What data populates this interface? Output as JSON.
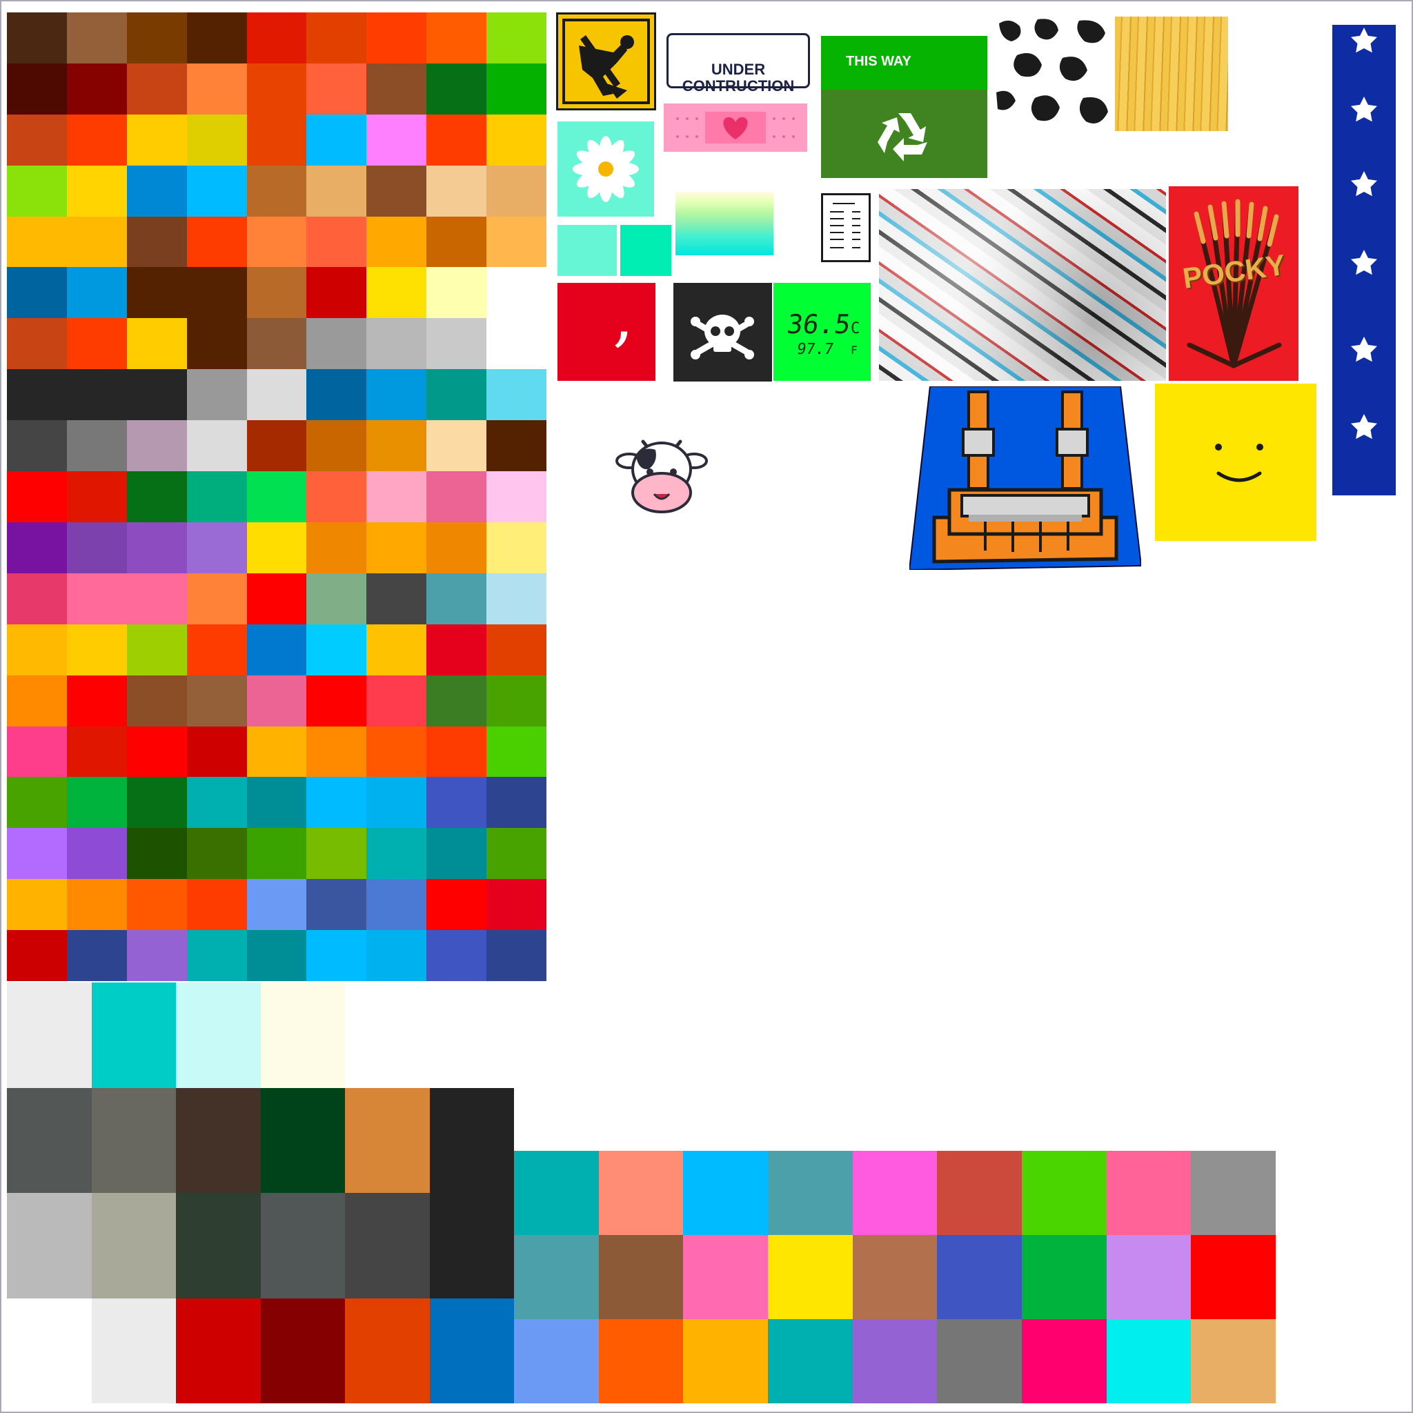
{
  "colors": {
    "background": "#ffffff",
    "frame": "#a9a9b6",
    "sign_yellow": "#f6c500",
    "mint": "#66f5d5",
    "arrow_green": "#05b300",
    "recycle_green": "#3f8421",
    "flag_blue": "#0e2ca3",
    "smiley_yellow": "#ffe600",
    "pocky_red": "#ed1c24",
    "temp_green": "#00ff33",
    "overalls_blue": "#0057e0",
    "overalls_orange": "#f5871f"
  },
  "stickers": {
    "worker_sign_icon": "digging-worker-icon",
    "under_construction_text": "UNDER\nCONTRUCTION",
    "this_way_text": "THIS WAY",
    "recycle_icon": "recycle-icon",
    "bandage_icon": "heart-bandage-icon",
    "daisy_icon": "daisy-icon",
    "receipt_icon": "receipt-icon",
    "comma_glyph": ",",
    "skull_icon": "skull-crossbones-icon",
    "temp_c": "36.5",
    "temp_c_unit": "C",
    "temp_f": "97.7",
    "temp_f_unit": "F",
    "pocky_text": "POCKY",
    "cow_icon": "cow-face-icon",
    "smiley_icon": "smiley-face-icon",
    "star_icon": "star-icon",
    "overalls_icon": "overalls-icon"
  },
  "swatches": {
    "main": [
      "#4a2812",
      "#93603a",
      "#7a3b00",
      "#552200",
      "#e11900",
      "#e24000",
      "#ff3d00",
      "#ff5c00",
      "#8ae20a",
      "#4e0a00",
      "#850200",
      "#c94414",
      "#ff8238",
      "#e84400",
      "#ff623a",
      "#8c4e27",
      "#067016",
      "#04b000",
      "#c94414",
      "#ff3c00",
      "#ffcc00",
      "#dfcf00",
      "#e84400",
      "#00bbff",
      "#ff80ff",
      "#ff3c00",
      "#ffcc00",
      "#8ae20a",
      "#ffd400",
      "#0088d4",
      "#00bbff",
      "#b86a28",
      "#e9ae66",
      "#8c4e27",
      "#f4cc93",
      "#e9ae66",
      "#ffb900",
      "#ffb900",
      "#7a3f1f",
      "#ff3c00",
      "#ff8238",
      "#ff623a",
      "#ffa800",
      "#c96600",
      "#ffb74d",
      "#00649e",
      "#0099e0",
      "#552200",
      "#552200",
      "#b86a28",
      "#cf0000",
      "#ffe100",
      "#ffffb0",
      "#ffffff",
      "#c94414",
      "#ff3c00",
      "#ffcc00",
      "#552200",
      "#8c5a37",
      "#9a9a9a",
      "#b8b8b8",
      "#c9c9c9",
      "#ffffff",
      "#262626",
      "#262626",
      "#262626",
      "#999999",
      "#dcdcdc",
      "#00649e",
      "#0099e0",
      "#00998a",
      "#5fdaee",
      "#454545",
      "#787878",
      "#b599b1",
      "#dcdcdc",
      "#a52a00",
      "#c96600",
      "#e99000",
      "#fcdaa3",
      "#552200",
      "#ff0000",
      "#e01600",
      "#067016",
      "#00ad7d",
      "#00e050",
      "#ff623a",
      "#ffa6c4",
      "#ec6494",
      "#ffc5ef",
      "#7713a0",
      "#7d41ad",
      "#8e4cc1",
      "#9a6bd4",
      "#ffdd00",
      "#ef8700",
      "#ffa800",
      "#ef8700",
      "#ffee77",
      "#e8396b",
      "#ff6a9a",
      "#ff6a9a",
      "#ff8238",
      "#ff0000",
      "#7fae87",
      "#454545",
      "#4ba0aa",
      "#b1e0f1",
      "#ffb900",
      "#ffcc00",
      "#9ecf00",
      "#ff3c00",
      "#0079cf",
      "#00ccff",
      "#ffc200",
      "#e5001c",
      "#e24000",
      "#ff8a00",
      "#ff0000",
      "#8c4e27",
      "#93603a",
      "#ec6494",
      "#ff0000",
      "#ff3c4e",
      "#3a7d22",
      "#48a300",
      "#ff3e8b",
      "#e01600",
      "#ff0000",
      "#cf0000",
      "#ffb300",
      "#ff8a00",
      "#ff5800",
      "#ff3c00",
      "#4acf00",
      "#48a300",
      "#00b33c",
      "#067016",
      "#00b0b1",
      "#008e96",
      "#00bbff",
      "#00b1f0",
      "#3f55c1",
      "#2d4490",
      "#b36bff",
      "#8e4cd6",
      "#1d5200",
      "#3a7000",
      "#3aa300",
      "#78bc00",
      "#00b0b1",
      "#008e96",
      "#48a300",
      "#ffb300",
      "#ff8a00",
      "#ff5800",
      "#ff3c00",
      "#6a9af3",
      "#3a56a1",
      "#4a7ad4",
      "#ff0000",
      "#e5001c",
      "#cc0000",
      "#2d4490",
      "#9562d4",
      "#00b0b1",
      "#008e96",
      "#00bbff",
      "#00b1f0",
      "#3f55c1",
      "#2d4490"
    ],
    "bottom_left": [
      "#ececec",
      "#00cdc6",
      "#c8fbf7",
      "#fefbe6",
      "#ffffff",
      "#ffffff",
      "#535756",
      "#696860",
      "#443228",
      "#00431a",
      "#d78537",
      "#232323",
      "#bababa",
      "#a9a99a",
      "#2e3f31",
      "#515756",
      "#454545",
      "#232323",
      "#ffffff",
      "#ebebeb",
      "#cf0000",
      "#850000",
      "#e24000",
      "#0070be"
    ],
    "bottom_left_last_row": [
      "#2d4434",
      "#080808",
      "#232323",
      "#232323",
      "#67665e",
      "#525756"
    ],
    "bottom_right": [
      "#00b0b1",
      "#ff8c74",
      "#00bbff",
      "#4ba0aa",
      "#ff5be0",
      "#cb4a3c",
      "#4ad400",
      "#ff6398",
      "#919191",
      "#4ba0aa",
      "#8c5a37",
      "#ff6ab0",
      "#ffe600",
      "#b3704d",
      "#3f55c1",
      "#00b33c",
      "#c78af0",
      "#ff0000",
      "#6a9af3",
      "#ff5c00",
      "#ffb300",
      "#00b0b1",
      "#9562d4",
      "#767676",
      "#ff006e",
      "#00eeee",
      "#e9ae66"
    ]
  }
}
